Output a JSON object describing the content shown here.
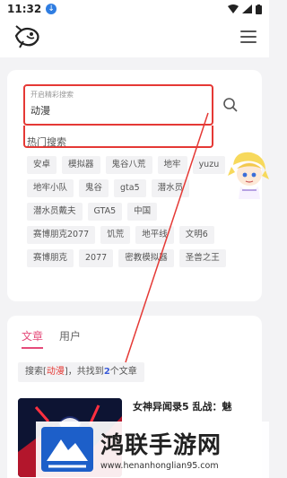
{
  "statusbar": {
    "time": "11:32"
  },
  "search": {
    "placeholder_label": "开启精彩搜索",
    "value": "动漫"
  },
  "hot": {
    "title": "热门搜索",
    "rows": [
      [
        "安卓",
        "模拟器",
        "鬼谷八荒",
        "地牢",
        "yuzu"
      ],
      [
        "地牢小队",
        "鬼谷",
        "gta5",
        "潜水员"
      ],
      [
        "潜水员戴夫",
        "GTA5",
        "中国"
      ],
      [
        "赛博朋克2077",
        "饥荒",
        "地平线",
        "文明6"
      ],
      [
        "赛博朋克",
        "2077",
        "密教模拟器",
        "圣兽之王"
      ]
    ]
  },
  "results": {
    "tabs": [
      {
        "label": "文章"
      },
      {
        "label": "用户"
      }
    ],
    "note_prefix": "搜索[",
    "keyword": "动漫",
    "note_middle": "]，共找到",
    "count": "2",
    "note_suffix": "个文章",
    "first_item_title": "女神异闻录5 乱战：魅"
  },
  "watermark": {
    "name": "鸿联手游网",
    "url": "www.henanhonglian95.com"
  },
  "colors": {
    "accent_pink": "#e54b7a",
    "highlight_red": "#e53935",
    "link_blue": "#3a5bd9"
  }
}
